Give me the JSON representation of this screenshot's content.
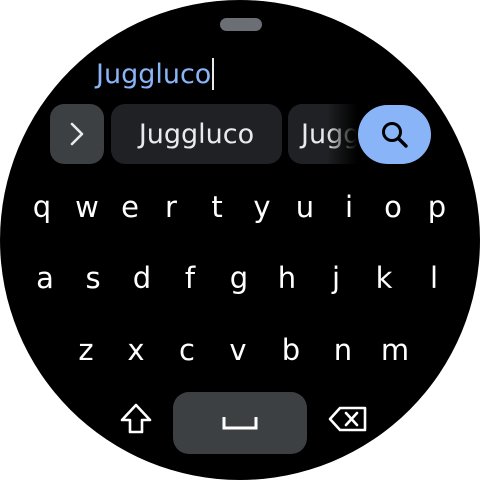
{
  "input": {
    "value": "Juggluco"
  },
  "suggestions": [
    {
      "label": "Juggluco"
    },
    {
      "label": "Jugg"
    }
  ],
  "keyboard": {
    "row1": [
      "q",
      "w",
      "e",
      "r",
      "t",
      "y",
      "u",
      "i",
      "o",
      "p"
    ],
    "row2": [
      "a",
      "s",
      "d",
      "f",
      "g",
      "h",
      "j",
      "k",
      "l"
    ],
    "row3": [
      "z",
      "x",
      "c",
      "v",
      "b",
      "n",
      "m"
    ],
    "icons": {
      "expand": "chevron-right-icon",
      "search": "search-icon",
      "shift": "shift-arrow-icon",
      "space": "space-bar-icon",
      "backspace": "backspace-icon"
    }
  },
  "colors": {
    "background": "#000000",
    "accent": "#8ab4f8",
    "key_surface": "#3c4043",
    "chip_surface": "#202124",
    "text": "#ffffff"
  }
}
